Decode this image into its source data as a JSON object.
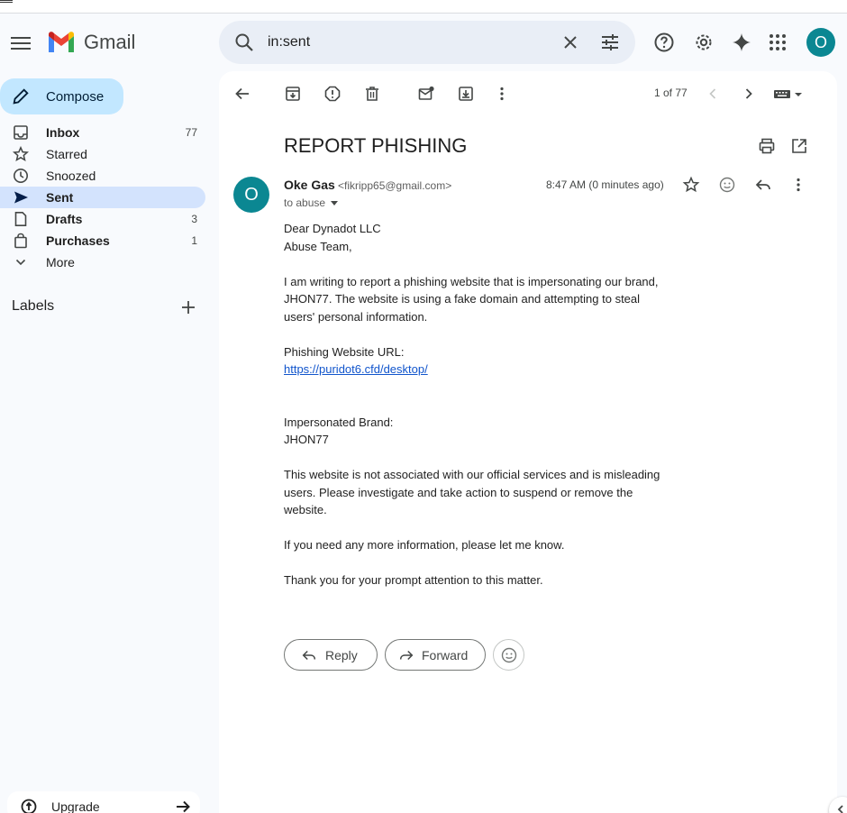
{
  "app": {
    "name": "Gmail"
  },
  "search": {
    "query": "in:sent"
  },
  "header": {
    "avatar_letter": "O"
  },
  "sidebar": {
    "compose_label": "Compose",
    "items": [
      {
        "label": "Inbox",
        "count": "77",
        "icon": "inbox-icon",
        "bold": true
      },
      {
        "label": "Starred",
        "count": "",
        "icon": "star-icon",
        "bold": false
      },
      {
        "label": "Snoozed",
        "count": "",
        "icon": "clock-icon",
        "bold": false
      },
      {
        "label": "Sent",
        "count": "",
        "icon": "send-icon",
        "bold": true
      },
      {
        "label": "Drafts",
        "count": "3",
        "icon": "draft-icon",
        "bold": true
      },
      {
        "label": "Purchases",
        "count": "1",
        "icon": "purchases-icon",
        "bold": true
      },
      {
        "label": "More",
        "count": "",
        "icon": "chevron-down-icon",
        "bold": false
      }
    ],
    "labels_heading": "Labels",
    "upgrade_label": "Upgrade"
  },
  "toolbar": {
    "pager": "1 of 77"
  },
  "email": {
    "subject": "REPORT PHISHING",
    "sender_initial": "O",
    "sender_name": "Oke Gas",
    "sender_email": "<fikripp65@gmail.com>",
    "to": "to abuse",
    "timestamp": "8:47 AM (0 minutes ago)",
    "body": {
      "greeting_1": "Dear Dynadot LLC",
      "greeting_2": "Abuse Team,",
      "para_1": "I am writing to report a phishing website that is impersonating our brand, JHON77. The website is using a fake domain and attempting to steal users' personal information.",
      "url_label": "Phishing Website URL:",
      "url": "https://puridot6.cfd/desktop/",
      "brand_label": "Impersonated Brand:",
      "brand": "JHON77",
      "para_2": "This website is not associated with our official services and is misleading users. Please investigate and take action to suspend or remove the website.",
      "para_3": "If you need any more information, please let me know.",
      "para_4": "Thank you for your prompt attention to this matter."
    },
    "reply_label": "Reply",
    "forward_label": "Forward"
  }
}
